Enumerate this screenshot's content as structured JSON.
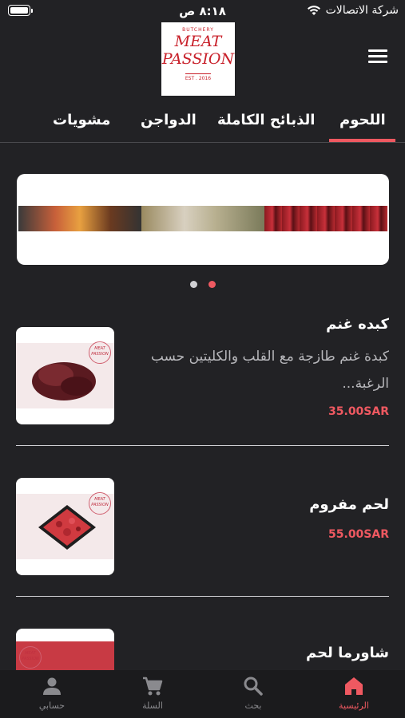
{
  "status_bar": {
    "time": "٨:١٨ ص",
    "carrier": "شركة الاتصالات"
  },
  "header": {
    "logo": {
      "top_text": "BUTCHERY",
      "line1": "MEAT",
      "line2": "PASSION",
      "est": "EST . 2016"
    },
    "menu_icon": "hamburger-icon"
  },
  "tabs": [
    {
      "label": "اللحوم",
      "active": true
    },
    {
      "label": "الذبائح الكاملة",
      "active": false
    },
    {
      "label": "الدواجن",
      "active": false
    },
    {
      "label": "مشويات",
      "active": false
    }
  ],
  "carousel": {
    "dots": 2,
    "active_index": 1
  },
  "products": [
    {
      "name": "كبده غنم",
      "description": "كبدة غنم طازجة مع القلب والكليتين حسب الرغبة...",
      "price": "35.00SAR"
    },
    {
      "name": "لحم مفروم",
      "description": "",
      "price": "55.00SAR"
    },
    {
      "name": "شاورما لحم",
      "description": "",
      "price": ""
    }
  ],
  "bottom_nav": [
    {
      "label": "الرئيسية",
      "icon": "home-icon",
      "active": true
    },
    {
      "label": "بحث",
      "icon": "search-icon",
      "active": false
    },
    {
      "label": "السلة",
      "icon": "cart-icon",
      "active": false
    },
    {
      "label": "حسابي",
      "icon": "person-icon",
      "active": false
    }
  ],
  "colors": {
    "background": "#222225",
    "accent": "#ef5961",
    "muted_text": "#b8b8bc"
  }
}
